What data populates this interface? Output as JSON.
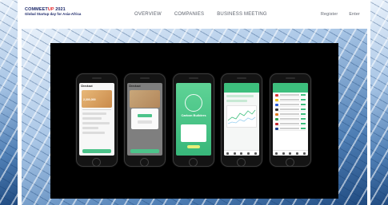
{
  "header": {
    "logo_brand_prefix": "COMMEET",
    "logo_brand_accent": "UP",
    "logo_brand_year": " 2021",
    "logo_subtitle": "Global Startup day for Asia-Africa",
    "nav": [
      "OVERVIEW",
      "COMPANIES",
      "BUSINESS MEETING"
    ],
    "auth": [
      "Register",
      "Enter"
    ]
  },
  "showcase": {
    "phones": [
      {
        "screen": "checkout",
        "title": "Checkout",
        "amount": "2,300,000"
      },
      {
        "screen": "checkout-modal",
        "title": "Checkout"
      },
      {
        "screen": "splash",
        "brand": "Carbon Builders"
      },
      {
        "screen": "dashboard"
      },
      {
        "screen": "list"
      }
    ]
  },
  "colors": {
    "brand_navy": "#1e2a6b",
    "brand_red": "#e5282b",
    "app_green": "#3dbf7d",
    "card_gold": "#d89c5e"
  }
}
